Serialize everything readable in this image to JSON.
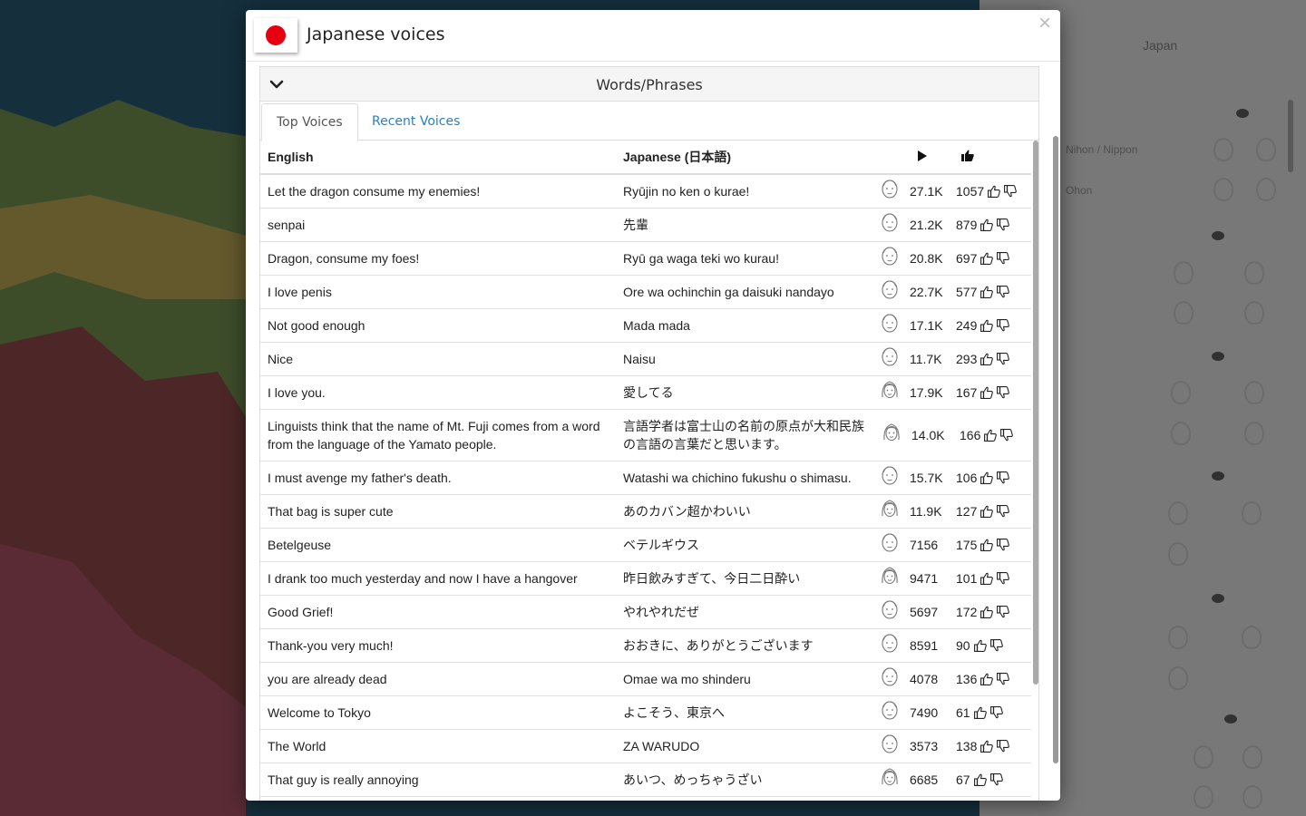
{
  "modal": {
    "title": "Japanese voices",
    "close_glyph": "×"
  },
  "panel": {
    "heading": "Words/Phrases"
  },
  "tabs": [
    {
      "label": "Top Voices",
      "active": true
    },
    {
      "label": "Recent Voices",
      "active": false
    }
  ],
  "table": {
    "headers": {
      "english": "English",
      "japanese": "Japanese (日本語)",
      "play_icon": "play-icon",
      "likes_icon": "thumbs-up-icon"
    },
    "rows": [
      {
        "english": "Let the dragon consume my enemies!",
        "japanese": "Ryūjin no ken o kurae!",
        "gender": "male",
        "plays": "27.1K",
        "likes": "1057"
      },
      {
        "english": "senpai",
        "japanese": "先輩",
        "gender": "male",
        "plays": "21.2K",
        "likes": "879"
      },
      {
        "english": "Dragon, consume my foes!",
        "japanese": "Ryū ga waga teki wo kurau!",
        "gender": "male",
        "plays": "20.8K",
        "likes": "697"
      },
      {
        "english": "I love penis",
        "japanese": "Ore wa ochinchin ga daisuki nandayo",
        "gender": "male",
        "plays": "22.7K",
        "likes": "577"
      },
      {
        "english": "Not good enough",
        "japanese": "Mada mada",
        "gender": "male",
        "plays": "17.1K",
        "likes": "249"
      },
      {
        "english": "Nice",
        "japanese": "Naisu",
        "gender": "male",
        "plays": "11.7K",
        "likes": "293"
      },
      {
        "english": "I love you.",
        "japanese": "愛してる",
        "gender": "female",
        "plays": "17.9K",
        "likes": "167"
      },
      {
        "english": "Linguists think that the name of Mt. Fuji comes from a word from the language of the Yamato people.",
        "japanese": "言語学者は富士山の名前の原点が大和民族の言語の言葉だと思います。",
        "gender": "female",
        "plays": "14.0K",
        "likes": "166",
        "tall": true
      },
      {
        "english": "I must avenge my father's death.",
        "japanese": "Watashi wa chichino fukushu o shimasu.",
        "gender": "male",
        "plays": "15.7K",
        "likes": "106"
      },
      {
        "english": "That bag is super cute",
        "japanese": "あのカバン超かわいい",
        "gender": "female",
        "plays": "11.9K",
        "likes": "127"
      },
      {
        "english": "Betelgeuse",
        "japanese": "ベテルギウス",
        "gender": "male",
        "plays": "7156",
        "likes": "175"
      },
      {
        "english": "I drank too much yesterday and now I have a hangover",
        "japanese": "昨日飲みすぎて、今日二日酔い",
        "gender": "female",
        "plays": "9471",
        "likes": "101"
      },
      {
        "english": "Good Grief!",
        "japanese": "やれやれだぜ",
        "gender": "male",
        "plays": "5697",
        "likes": "172"
      },
      {
        "english": "Thank-you very much!",
        "japanese": "おおきに、ありがとうございます",
        "gender": "male",
        "plays": "8591",
        "likes": "90"
      },
      {
        "english": "you are already dead",
        "japanese": "Omae wa mo shinderu",
        "gender": "male",
        "plays": "4078",
        "likes": "136"
      },
      {
        "english": "Welcome to Tokyo",
        "japanese": "よこそう、東京へ",
        "gender": "male",
        "plays": "7490",
        "likes": "61"
      },
      {
        "english": "The World",
        "japanese": "ZA WARUDO",
        "gender": "male",
        "plays": "3573",
        "likes": "138"
      },
      {
        "english": "That guy is really annoying",
        "japanese": "あいつ、めっちゃうざい",
        "gender": "female",
        "plays": "6685",
        "likes": "67"
      }
    ]
  },
  "side_panel": {
    "title": "Japan",
    "sub1": "Nihon / Nippon",
    "sub2": "Ohon"
  },
  "colors": {
    "flag_red": "#e60012",
    "link_blue": "#2a7fc0"
  }
}
